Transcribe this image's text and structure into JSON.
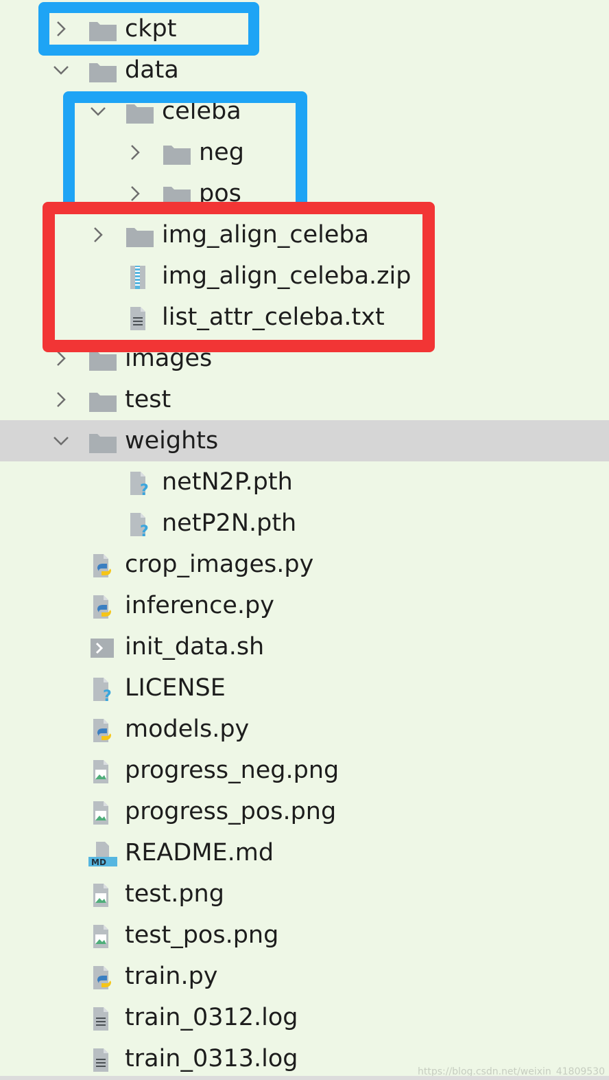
{
  "tree": {
    "items": [
      {
        "label": "ckpt",
        "depth": 0,
        "type": "folder",
        "state": "collapsed"
      },
      {
        "label": "data",
        "depth": 0,
        "type": "folder",
        "state": "expanded"
      },
      {
        "label": "celeba",
        "depth": 1,
        "type": "folder",
        "state": "expanded"
      },
      {
        "label": "neg",
        "depth": 2,
        "type": "folder",
        "state": "collapsed"
      },
      {
        "label": "pos",
        "depth": 2,
        "type": "folder",
        "state": "collapsed"
      },
      {
        "label": "img_align_celeba",
        "depth": 1,
        "type": "folder",
        "state": "collapsed"
      },
      {
        "label": "img_align_celeba.zip",
        "depth": 1,
        "type": "zip"
      },
      {
        "label": "list_attr_celeba.txt",
        "depth": 1,
        "type": "text"
      },
      {
        "label": "images",
        "depth": 0,
        "type": "folder",
        "state": "collapsed"
      },
      {
        "label": "test",
        "depth": 0,
        "type": "folder",
        "state": "collapsed"
      },
      {
        "label": "weights",
        "depth": 0,
        "type": "folder",
        "state": "expanded",
        "selected": true
      },
      {
        "label": "netN2P.pth",
        "depth": 1,
        "type": "unknown"
      },
      {
        "label": "netP2N.pth",
        "depth": 1,
        "type": "unknown"
      },
      {
        "label": "crop_images.py",
        "depth": 0,
        "type": "python"
      },
      {
        "label": "inference.py",
        "depth": 0,
        "type": "python"
      },
      {
        "label": "init_data.sh",
        "depth": 0,
        "type": "shell"
      },
      {
        "label": "LICENSE",
        "depth": 0,
        "type": "unknown"
      },
      {
        "label": "models.py",
        "depth": 0,
        "type": "python"
      },
      {
        "label": "progress_neg.png",
        "depth": 0,
        "type": "image"
      },
      {
        "label": "progress_pos.png",
        "depth": 0,
        "type": "image"
      },
      {
        "label": "README.md",
        "depth": 0,
        "type": "markdown"
      },
      {
        "label": "test.png",
        "depth": 0,
        "type": "image"
      },
      {
        "label": "test_pos.png",
        "depth": 0,
        "type": "image"
      },
      {
        "label": "train.py",
        "depth": 0,
        "type": "python"
      },
      {
        "label": "train_0312.log",
        "depth": 0,
        "type": "text"
      },
      {
        "label": "train_0313.log",
        "depth": 0,
        "type": "text"
      }
    ]
  },
  "highlights": [
    {
      "color": "#1ea4f5"
    },
    {
      "color": "#1ea4f5"
    },
    {
      "color": "#f23535"
    }
  ],
  "icons": {
    "folder": "folder-icon",
    "zip": "zip-file-icon",
    "text": "text-file-icon",
    "unknown": "unknown-file-icon",
    "python": "python-file-icon",
    "shell": "shell-script-icon",
    "image": "image-file-icon",
    "markdown": "markdown-file-icon",
    "chevron_collapsed": "chevron-right-icon",
    "chevron_expanded": "chevron-down-icon"
  },
  "colors": {
    "background": "#eef7e6",
    "selected_row": "#d6d6d6",
    "folder": "#a9afb3",
    "text": "#1d1d1d"
  },
  "watermark": "https://blog.csdn.net/weixin_41809530"
}
